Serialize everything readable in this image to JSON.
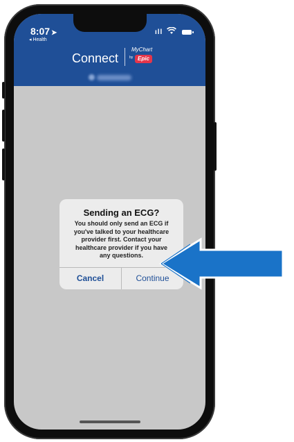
{
  "status_bar": {
    "time": "8:07",
    "location_arrow": "➤",
    "back_label": "◂ Health",
    "signal": "ıll"
  },
  "header": {
    "title": "Connect",
    "logo_top": "MyChart",
    "logo_by": "by",
    "logo_brand": "Epic"
  },
  "dialog": {
    "title": "Sending an ECG?",
    "message": "You should only send an ECG if\nyou've talked to your healthcare\nprovider first. Contact your\nhealthcare provider if you have\nany questions.",
    "cancel_label": "Cancel",
    "continue_label": "Continue"
  },
  "colors": {
    "header_bg": "#1f4f97",
    "pointer_arrow": "#1a73c8",
    "dim_overlay": "#c8c8c8"
  }
}
